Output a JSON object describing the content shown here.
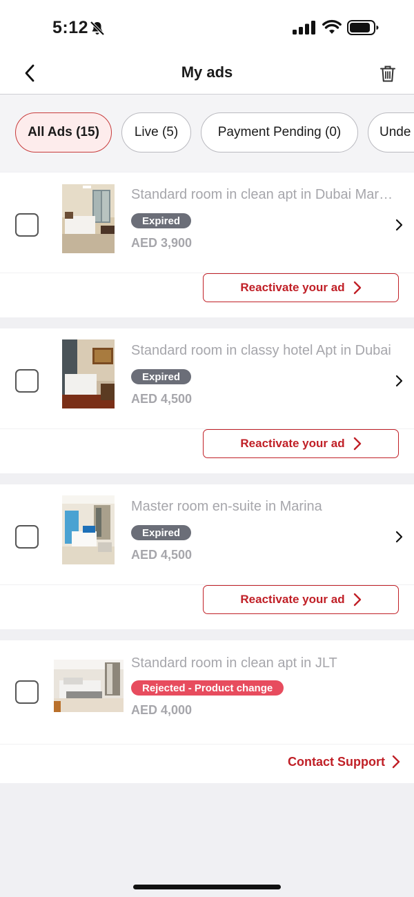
{
  "status_bar": {
    "time": "5:12"
  },
  "header": {
    "title": "My ads"
  },
  "filters": [
    {
      "label": "All Ads (15)",
      "active": true
    },
    {
      "label": "Live (5)",
      "active": false
    },
    {
      "label": "Payment Pending (0)",
      "active": false
    },
    {
      "label": "Unde",
      "active": false
    }
  ],
  "ads": [
    {
      "title": "Standard room in clean apt in Dubai Marina",
      "status": "Expired",
      "price": "AED 3,900",
      "action": "Reactivate your ad"
    },
    {
      "title": "Standard room in classy hotel Apt in Dubai",
      "status": "Expired",
      "price": "AED 4,500",
      "action": "Reactivate your ad"
    },
    {
      "title": "Master room en-suite in Marina",
      "status": "Expired",
      "price": "AED 4,500",
      "action": "Reactivate your ad"
    },
    {
      "title": "Standard room in clean apt in JLT",
      "status": "Rejected - Product change",
      "price": "AED 4,000",
      "action": "Contact Support"
    }
  ],
  "colors": {
    "accent": "#c01f26",
    "expired_badge": "#6b6e78",
    "rejected_badge": "#e74c5e",
    "chip_active_bg": "#fdecec"
  }
}
